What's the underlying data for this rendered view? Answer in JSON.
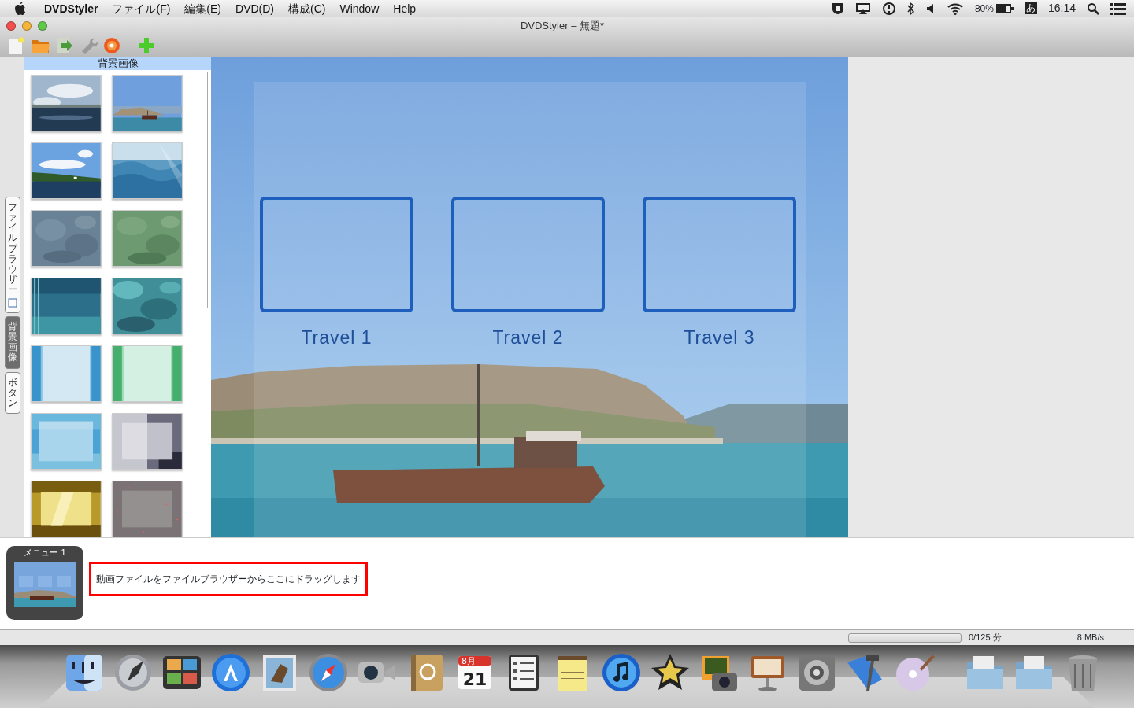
{
  "menubar": {
    "app": "DVDStyler",
    "menus": [
      "ファイル(F)",
      "編集(E)",
      "DVD(D)",
      "構成(C)",
      "Window",
      "Help"
    ],
    "battery": "80%",
    "input_mode": "あ",
    "clock": "16:14"
  },
  "window": {
    "title": "DVDStyler – 無題*"
  },
  "side_tabs": [
    {
      "label": "ファイルブラウザー",
      "selected": false
    },
    {
      "label": "背景画像",
      "selected": true
    },
    {
      "label": "ボタン",
      "selected": false
    }
  ],
  "panel": {
    "title": "背景画像"
  },
  "menu_buttons": [
    {
      "label": "Travel 1"
    },
    {
      "label": "Travel 2"
    },
    {
      "label": "Travel 3"
    }
  ],
  "menus_strip": [
    {
      "title": "メニュー 1"
    }
  ],
  "drop_hint": "動画ファイルをファイルブラウザーからここにドラッグします",
  "status_bar": {
    "level": 0,
    "duration": "0/125 分",
    "bitrate": "8 MB/s"
  },
  "dock": {
    "calendar_month": "8月",
    "calendar_day": "21"
  }
}
